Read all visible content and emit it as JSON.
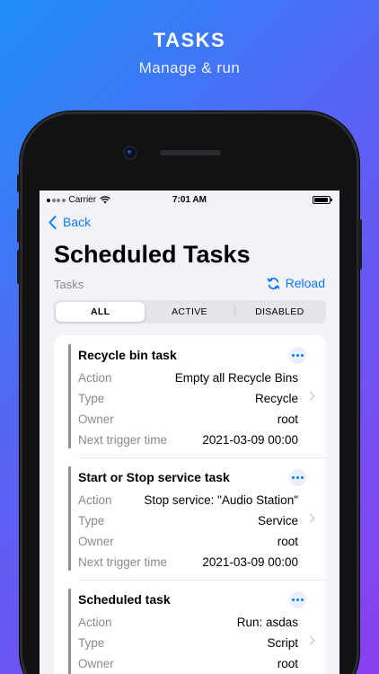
{
  "hero": {
    "title": "TASKS",
    "subtitle": "Manage & run"
  },
  "status_bar": {
    "carrier": "Carrier",
    "time": "7:01 AM"
  },
  "nav": {
    "back_label": "Back"
  },
  "page": {
    "title": "Scheduled Tasks",
    "section_label": "Tasks",
    "reload_label": "Reload"
  },
  "filter": {
    "options": [
      "ALL",
      "ACTIVE",
      "DISABLED"
    ],
    "selected": "ALL"
  },
  "field_labels": {
    "action": "Action",
    "type": "Type",
    "owner": "Owner",
    "next_trigger": "Next trigger time"
  },
  "tasks": [
    {
      "title": "Recycle bin task",
      "action": "Empty all Recycle Bins",
      "type": "Recycle",
      "owner": "root",
      "next_trigger": "2021-03-09 00:00"
    },
    {
      "title": "Start or Stop service task",
      "action": "Stop service: \"Audio Station\"",
      "type": "Service",
      "owner": "root",
      "next_trigger": "2021-03-09 00:00"
    },
    {
      "title": "Scheduled task",
      "action": "Run: asdas",
      "type": "Script",
      "owner": "root",
      "next_trigger": ""
    }
  ],
  "icons": {
    "back": "chevron-left-icon",
    "reload": "reload-icon",
    "more": "ellipsis-icon",
    "detail": "chevron-right-icon",
    "wifi": "wifi-icon",
    "battery": "battery-icon",
    "signal": "signal-dots-icon"
  },
  "colors": {
    "accent": "#0a7aff",
    "background_gradient_start": "#1f8ff7",
    "background_gradient_end": "#8a3ff0",
    "task_bar": "#8e8e93"
  }
}
